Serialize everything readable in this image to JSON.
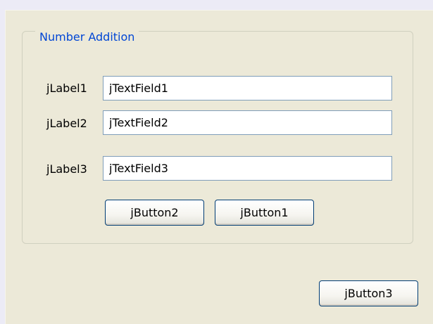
{
  "group": {
    "title": "Number Addition"
  },
  "rows": [
    {
      "label": "jLabel1",
      "field_value": "jTextField1"
    },
    {
      "label": "jLabel2",
      "field_value": "jTextField2"
    },
    {
      "label": "jLabel3",
      "field_value": "jTextField3"
    }
  ],
  "buttons": {
    "button2": "jButton2",
    "button1": "jButton1",
    "button3": "jButton3"
  },
  "colors": {
    "title_blue": "#0046d5",
    "panel_bg": "#ece9d8",
    "field_border": "#7f9db9",
    "button_border": "#003c74"
  }
}
